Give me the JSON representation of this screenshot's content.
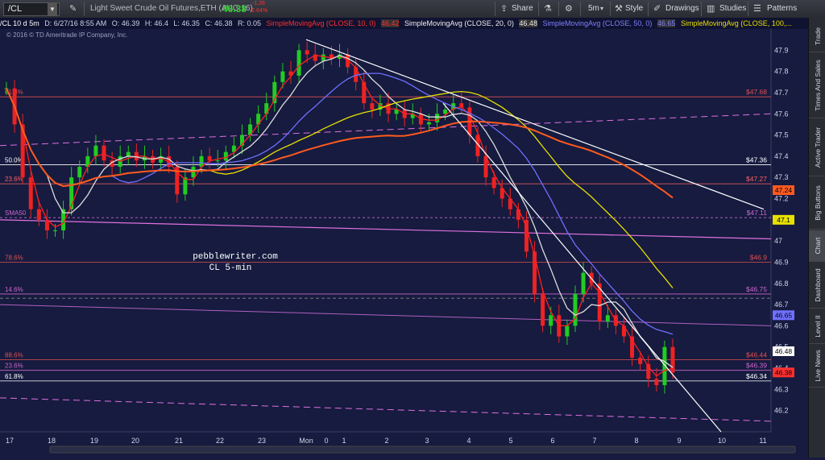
{
  "toolbar": {
    "symbol": "/CL",
    "description": "Light Sweet Crude Oil Futures,ETH (AUG 16)",
    "last_price": "46.38",
    "change": "-1.26",
    "change_pct": "-2.64%",
    "share_label": "Share",
    "timeframe": "5m",
    "style_label": "Style",
    "drawings_label": "Drawings",
    "studies_label": "Studies",
    "patterns_label": "Patterns",
    "accent_color": "#33cc33",
    "down_color": "#ff3030"
  },
  "infobar": {
    "chart_label": "/CL 10 d 5m",
    "date": "D: 6/27/16 8:55 AM",
    "open": "O: 46.39",
    "high": "H: 46.4",
    "low": "L: 46.35",
    "close": "C: 46.38",
    "range": "R: 0.05",
    "sma10_label": "SimpleMovingAvg (CLOSE, 10, 0)",
    "sma10_value": "46.42",
    "sma20_label": "SimpleMovingAvg (CLOSE, 20, 0)",
    "sma20_value": "46.48",
    "sma50_label": "SimpleMovingAvg (CLOSE, 50, 0)",
    "sma50_value": "46.65",
    "sma100_label": "SimpleMovingAvg (CLOSE, 100,...",
    "copyright": "© 2016 © TD Ameritrade IP Company, Inc."
  },
  "watermark": {
    "line1": "pebblewriter.com",
    "line2": "CL 5-min"
  },
  "sidebar": {
    "tabs": [
      "Trade",
      "Times And Sales",
      "Active Trader",
      "Big Buttons",
      "Chart",
      "Dashboard",
      "Level II",
      "Live News"
    ]
  },
  "chart_data": {
    "type": "candlestick",
    "ylim": [
      46.1,
      48.0
    ],
    "y_ticks": [
      "47.9",
      "47.8",
      "47.7",
      "47.6",
      "47.5",
      "47.4",
      "47.3",
      "47.2",
      "47.1",
      "47",
      "46.9",
      "46.8",
      "46.7",
      "46.6",
      "46.5",
      "46.4",
      "46.3",
      "46.2"
    ],
    "x_ticks": [
      "17",
      "18",
      "19",
      "20",
      "21",
      "22",
      "23",
      "Mon",
      "0",
      "1",
      "2",
      "3",
      "4",
      "5",
      "6",
      "7",
      "8",
      "9",
      "10",
      "11"
    ],
    "fib_levels": [
      {
        "left": "61.8%",
        "right": "$47.68",
        "price": 47.68,
        "color": "#e05050"
      },
      {
        "left": "50.0%",
        "right": "$47.36",
        "price": 47.36,
        "color": "#ffffff"
      },
      {
        "left": "23.6%",
        "right": "$47.27",
        "price": 47.27,
        "color": "#ff6060"
      },
      {
        "left": "SMA50",
        "right": "$47.11",
        "price": 47.11,
        "color": "#cc66cc"
      },
      {
        "left": "78.6%",
        "right": "$46.9",
        "price": 46.9,
        "color": "#e05050"
      },
      {
        "left": "14.6%",
        "right": "$46.75",
        "price": 46.75,
        "color": "#cc66cc"
      },
      {
        "left": "88.6%",
        "right": "$46.44",
        "price": 46.44,
        "color": "#e05050"
      },
      {
        "left": "23.6%",
        "right": "$46.39",
        "price": 46.39,
        "color": "#cc66cc"
      },
      {
        "left": "61.8%",
        "right": "$46.34",
        "price": 46.34,
        "color": "#ffffff"
      }
    ],
    "price_badges": [
      {
        "label": "47.24",
        "price": 47.24,
        "color": "#ff5a1f"
      },
      {
        "label": "47.1",
        "price": 47.1,
        "color": "#e8e000"
      },
      {
        "label": "46.65",
        "price": 46.65,
        "color": "#7070ff"
      },
      {
        "label": "46.48",
        "price": 46.48,
        "color": "#ffffff"
      },
      {
        "label": "46.38",
        "price": 46.38,
        "color": "#ff3030"
      }
    ],
    "sma_colors": {
      "sma10": "#ff2020",
      "sma20": "#dddddd",
      "sma50": "#6f6fff",
      "sma100": "#e8e000",
      "sma200": "#ff5a1f"
    },
    "closes": [
      47.72,
      47.55,
      47.3,
      47.15,
      47.1,
      47.05,
      47.05,
      47.15,
      47.3,
      47.35,
      47.4,
      47.45,
      47.38,
      47.35,
      47.4,
      47.42,
      47.38,
      47.4,
      47.37,
      47.4,
      47.35,
      47.22,
      47.3,
      47.35,
      47.4,
      47.38,
      47.38,
      47.42,
      47.45,
      47.5,
      47.55,
      47.6,
      47.65,
      47.75,
      47.8,
      47.78,
      47.9,
      47.88,
      47.85,
      47.88,
      47.86,
      47.88,
      47.82,
      47.75,
      47.65,
      47.62,
      47.65,
      47.6,
      47.62,
      47.58,
      47.6,
      47.55,
      47.56,
      47.6,
      47.62,
      47.65,
      47.63,
      47.5,
      47.4,
      47.3,
      47.25,
      47.2,
      47.15,
      47.1,
      46.95,
      46.75,
      46.6,
      46.65,
      46.55,
      46.6,
      46.75,
      46.85,
      46.8,
      46.62,
      46.65,
      46.6,
      46.55,
      46.45,
      46.42,
      46.35,
      46.32,
      46.5,
      46.38
    ]
  }
}
